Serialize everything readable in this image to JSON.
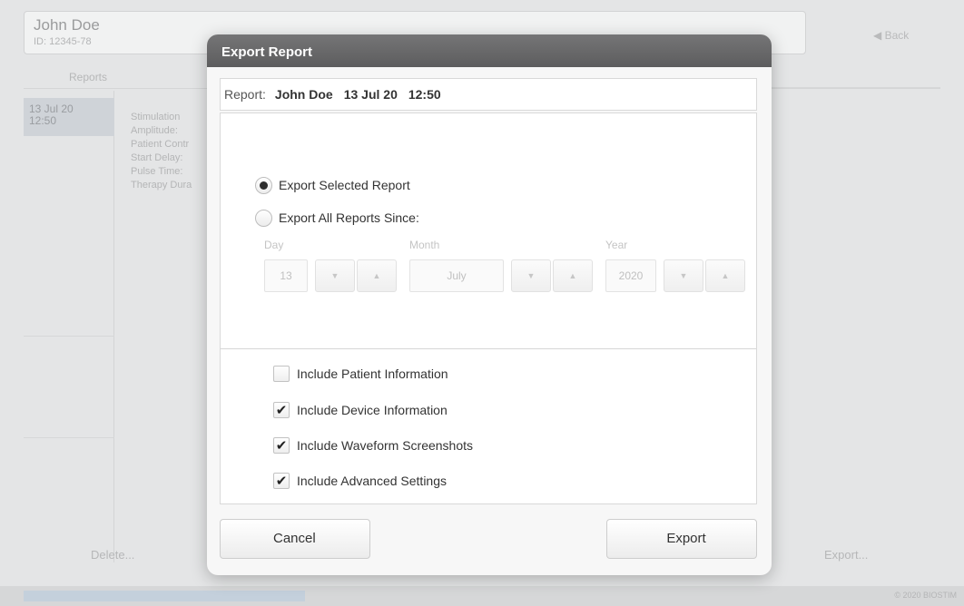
{
  "background": {
    "patient_name": "John Doe",
    "patient_id": "ID: 12345-78",
    "back_label": "◀ Back",
    "tab_label": "Reports",
    "report_date": "13 Jul 20",
    "report_time": "12:50",
    "detail_lines": [
      "Stimulation",
      "Amplitude: ",
      "Patient Contr",
      "Start Delay: ",
      "Pulse Time: ",
      "Therapy Dura"
    ],
    "delete_label": "Delete...",
    "export_label": "Export...",
    "status_text": "© 2020 BIOSTIM"
  },
  "dialog": {
    "title": "Export Report",
    "report_label": "Report:",
    "report_name": "John Doe",
    "report_date": "13 Jul 20",
    "report_time": "12:50",
    "options": {
      "selected_label": "Export Selected Report",
      "selected_checked": true,
      "all_since_label": "Export All Reports Since:",
      "all_since_checked": false
    },
    "date": {
      "day_label": "Day",
      "day_value": "13",
      "month_label": "Month",
      "month_value": "July",
      "year_label": "Year",
      "year_value": "2020",
      "down_glyph": "▼",
      "up_glyph": "▲"
    },
    "includes": [
      {
        "label": "Include Patient Information",
        "checked": false
      },
      {
        "label": "Include Device Information",
        "checked": true
      },
      {
        "label": "Include Waveform Screenshots",
        "checked": true
      },
      {
        "label": "Include Advanced Settings",
        "checked": true
      }
    ],
    "check_glyph": "✔",
    "cancel_label": "Cancel",
    "export_label": "Export"
  }
}
